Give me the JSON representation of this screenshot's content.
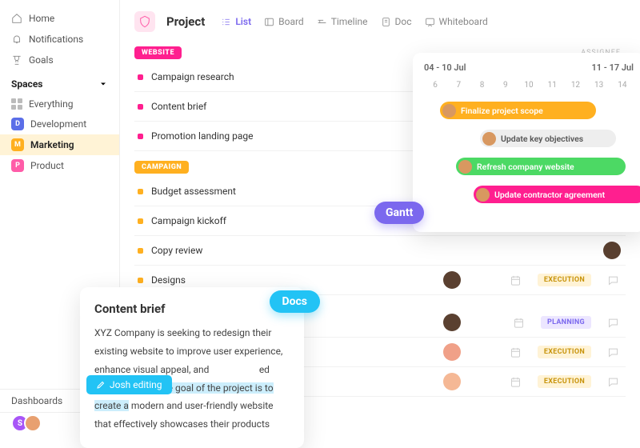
{
  "sidebar": {
    "nav": [
      {
        "label": "Home",
        "icon": "home"
      },
      {
        "label": "Notifications",
        "icon": "bell"
      },
      {
        "label": "Goals",
        "icon": "trophy"
      }
    ],
    "spaces_header": "Spaces",
    "everything": "Everything",
    "spaces": [
      {
        "label": "Development",
        "letter": "D",
        "cls": "dev"
      },
      {
        "label": "Marketing",
        "letter": "M",
        "cls": "mkt",
        "active": true
      },
      {
        "label": "Product",
        "letter": "P",
        "cls": "prod"
      }
    ],
    "bottom": [
      {
        "label": "Dashboards"
      },
      {
        "label": "Docs"
      }
    ],
    "user_letter": "S"
  },
  "header": {
    "title": "Project",
    "views": [
      {
        "label": "List",
        "icon": "list",
        "active": true
      },
      {
        "label": "Board",
        "icon": "board"
      },
      {
        "label": "Timeline",
        "icon": "timeline"
      },
      {
        "label": "Doc",
        "icon": "doc"
      },
      {
        "label": "Whiteboard",
        "icon": "whiteboard"
      }
    ],
    "col_assignee": "ASSIGNEE"
  },
  "groups": [
    {
      "name": "WEBSITE",
      "cls": "website",
      "dot": "pink",
      "tasks": [
        {
          "name": "Campaign research",
          "av": "a1"
        },
        {
          "name": "Content brief",
          "av": "a2"
        },
        {
          "name": "Promotion landing page",
          "av": "a3"
        }
      ]
    },
    {
      "name": "CAMPAIGN",
      "cls": "campaign",
      "dot": "yel",
      "tasks": [
        {
          "name": "Budget assessment",
          "av": "a1"
        },
        {
          "name": "Campaign kickoff",
          "av": "a3"
        },
        {
          "name": "Copy review",
          "av": "a4"
        },
        {
          "name": "Designs",
          "av": "a4",
          "status": "EXECUTION",
          "status_cls": "exec"
        }
      ]
    }
  ],
  "extra_tasks": [
    {
      "av": "a4",
      "status": "PLANNING",
      "status_cls": "plan"
    },
    {
      "av": "a5",
      "status": "EXECUTION",
      "status_cls": "exec"
    },
    {
      "av": "a6",
      "status": "EXECUTION",
      "status_cls": "exec"
    }
  ],
  "gantt": {
    "label": "Gantt",
    "range1": "04 - 10 Jul",
    "range2": "11 - 17 Jul",
    "days": [
      "6",
      "7",
      "8",
      "9",
      "10",
      "11",
      "12",
      "13",
      "14"
    ],
    "bars": [
      {
        "text": "Finalize project scope",
        "cls": "b1"
      },
      {
        "text": "Update key objectives",
        "cls": "b2"
      },
      {
        "text": "Refresh company website",
        "cls": "b3"
      },
      {
        "text": "Update contractor agreement",
        "cls": "b4"
      }
    ]
  },
  "docs": {
    "label": "Docs",
    "title": "Content brief",
    "body_pre": "XYZ Company is seeking to redesign their existing website to improve user experience, enhance visual appeal, and ",
    "body_mid": "ed brand identity. ",
    "body_hl": "The goal of the project is to create a",
    "body_post": " modern and user-friendly website that effectively showcases their products",
    "editing": "Josh editing"
  }
}
